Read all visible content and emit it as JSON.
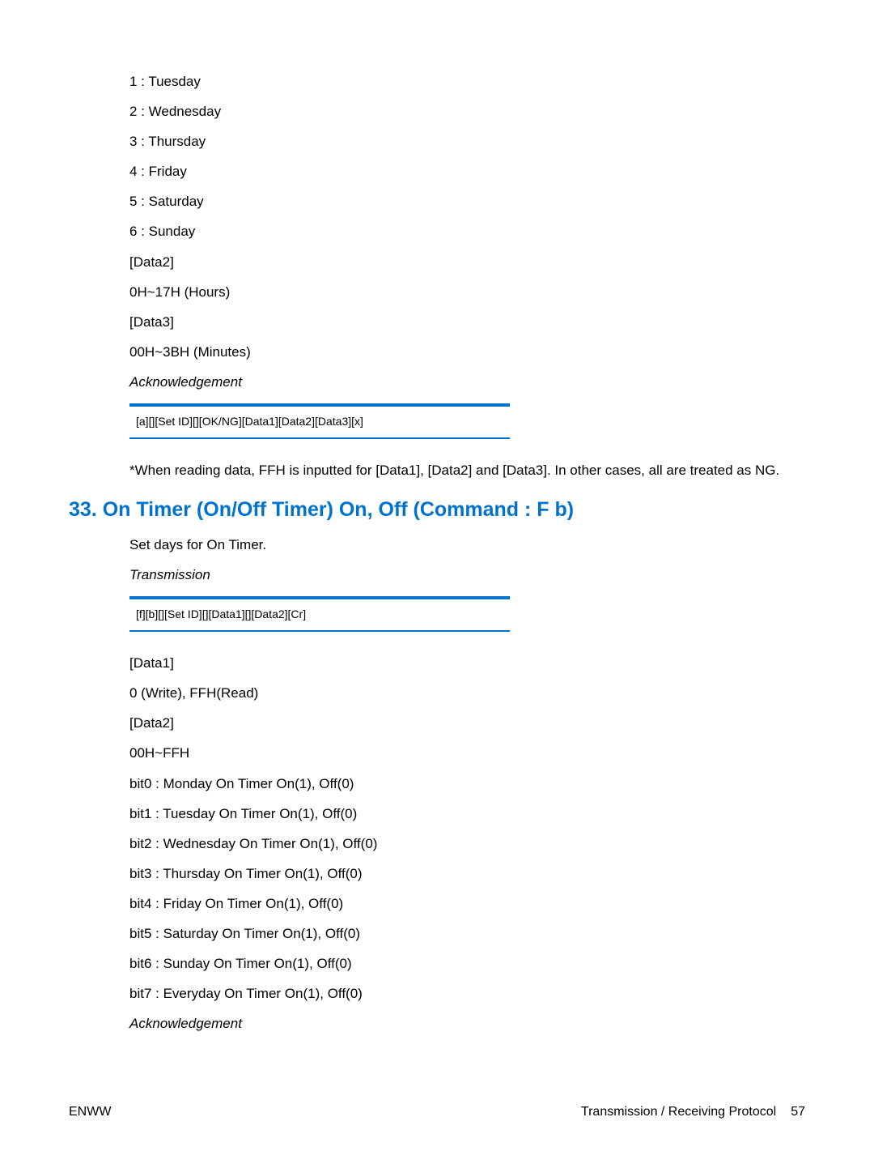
{
  "section1": {
    "lines": [
      "1 : Tuesday",
      "2 : Wednesday",
      "3 : Thursday",
      "4 : Friday",
      "5 : Saturday",
      "6 : Sunday",
      "[Data2]",
      "0H~17H (Hours)",
      "[Data3]",
      "00H~3BH (Minutes)"
    ],
    "ack_label": "Acknowledgement",
    "code": "[a][][Set ID][][OK/NG][Data1][Data2][Data3][x]",
    "note": "*When reading data, FFH is inputted for [Data1], [Data2] and [Data3]. In other cases, all are treated as NG."
  },
  "section2": {
    "heading": "33. On Timer (On/Off Timer) On, Off (Command : F b)",
    "intro": "Set days for On Timer.",
    "trans_label": "Transmission",
    "code": "[f][b][][Set ID][][Data1][][Data2][Cr]",
    "lines": [
      "[Data1]",
      "0 (Write), FFH(Read)",
      "[Data2]",
      "00H~FFH",
      "bit0 : Monday On Timer On(1), Off(0)",
      "bit1 : Tuesday On Timer On(1), Off(0)",
      "bit2 : Wednesday On Timer On(1), Off(0)",
      "bit3 : Thursday On Timer On(1), Off(0)",
      "bit4 : Friday On Timer On(1), Off(0)",
      "bit5 : Saturday On Timer On(1), Off(0)",
      "bit6 : Sunday On Timer On(1), Off(0)",
      "bit7 : Everyday On Timer On(1), Off(0)"
    ],
    "ack_label": "Acknowledgement"
  },
  "footer": {
    "left": "ENWW",
    "right_text": "Transmission / Receiving Protocol",
    "page": "57"
  }
}
